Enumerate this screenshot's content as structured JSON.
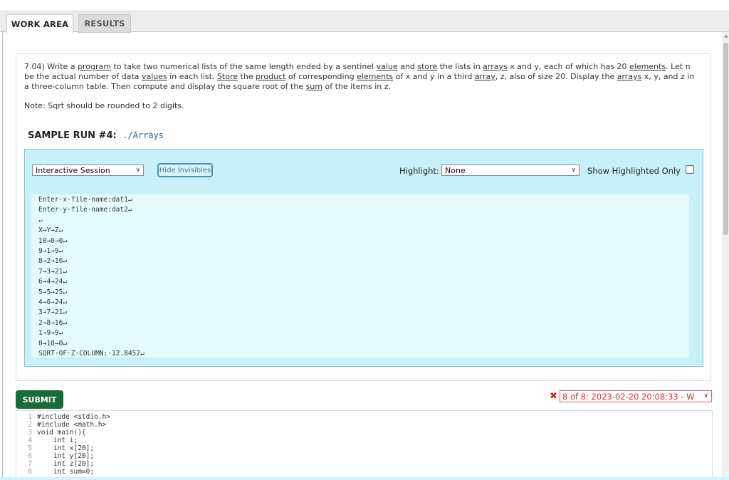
{
  "tabs": [
    {
      "label": "WORK AREA",
      "active": true
    },
    {
      "label": "RESULTS",
      "active": false
    }
  ],
  "question": {
    "segments": [
      {
        "text": "7.04) Write a ",
        "link": false
      },
      {
        "text": "program",
        "link": true
      },
      {
        "text": " to take two numerical lists of the same length ended by a sentinel ",
        "link": false
      },
      {
        "text": "value",
        "link": true
      },
      {
        "text": " and ",
        "link": false
      },
      {
        "text": "store",
        "link": true
      },
      {
        "text": " the lists in ",
        "link": false
      },
      {
        "text": "arrays",
        "link": true
      },
      {
        "text": " x and y, each of which has 20 ",
        "link": false
      },
      {
        "text": "elements",
        "link": true
      },
      {
        "text": ". Let n be the actual number of data ",
        "link": false
      },
      {
        "text": "values",
        "link": true
      },
      {
        "text": " in each list. ",
        "link": false
      },
      {
        "text": "Store",
        "link": true
      },
      {
        "text": " the ",
        "link": false
      },
      {
        "text": "product",
        "link": true
      },
      {
        "text": " of corresponding ",
        "link": false
      },
      {
        "text": "elements",
        "link": true
      },
      {
        "text": " of x and y in a third ",
        "link": false
      },
      {
        "text": "array",
        "link": true
      },
      {
        "text": ", z, also of size 20. Display the ",
        "link": false
      },
      {
        "text": "arrays",
        "link": true
      },
      {
        "text": " x, y, and z in a three-column table. Then compute and display the square root of the ",
        "link": false
      },
      {
        "text": "sum",
        "link": true
      },
      {
        "text": " of the items in z.",
        "link": false
      }
    ],
    "note": "Note: Sqrt should be rounded to 2 digits."
  },
  "sample_run": {
    "title": "SAMPLE RUN #4:",
    "command": "./Arrays"
  },
  "session": {
    "mode_select": "Interactive Session",
    "hide_invisibles_label": "Hide Invisibles",
    "highlight_label": "Highlight:",
    "highlight_value": "None",
    "show_highlighted_label": "Show Highlighted Only",
    "show_highlighted_checked": false,
    "output_lines": [
      "Enter·x·file·name:dat1↵",
      "Enter·y·file·name:dat2↵",
      "↵",
      "X→Y→Z↵",
      "10→0→0↵",
      "9→1→9↵",
      "8→2→16↵",
      "7→3→21↵",
      "6→4→24↵",
      "5→5→25↵",
      "4→6→24↵",
      "3→7→21↵",
      "2→8→16↵",
      "1→9→9↵",
      "0→10→0↵",
      "SQRT·OF·Z·COLUMN:·12.8452↵"
    ]
  },
  "submit_label": "SUBMIT",
  "run_history": {
    "status_icon": "x-icon",
    "selected": "8 of 8: 2023-02-20 20:08:33 - W"
  },
  "code_lines": [
    {
      "n": "1",
      "text": "#include <stdio.h>"
    },
    {
      "n": "2",
      "text": "#include <math.h>"
    },
    {
      "n": "3",
      "text": "void main(){"
    },
    {
      "n": "4",
      "text": "    int i;"
    },
    {
      "n": "5",
      "text": "    int x[20];"
    },
    {
      "n": "6",
      "text": "    int y[20];"
    },
    {
      "n": "7",
      "text": "    int z[20];"
    },
    {
      "n": "8",
      "text": "    int sum=0;"
    }
  ],
  "colors": {
    "submit": "#1a6b3b",
    "session_bg": "#c8f0f8",
    "output_bg": "#e4fbfd",
    "error": "#e02020"
  }
}
